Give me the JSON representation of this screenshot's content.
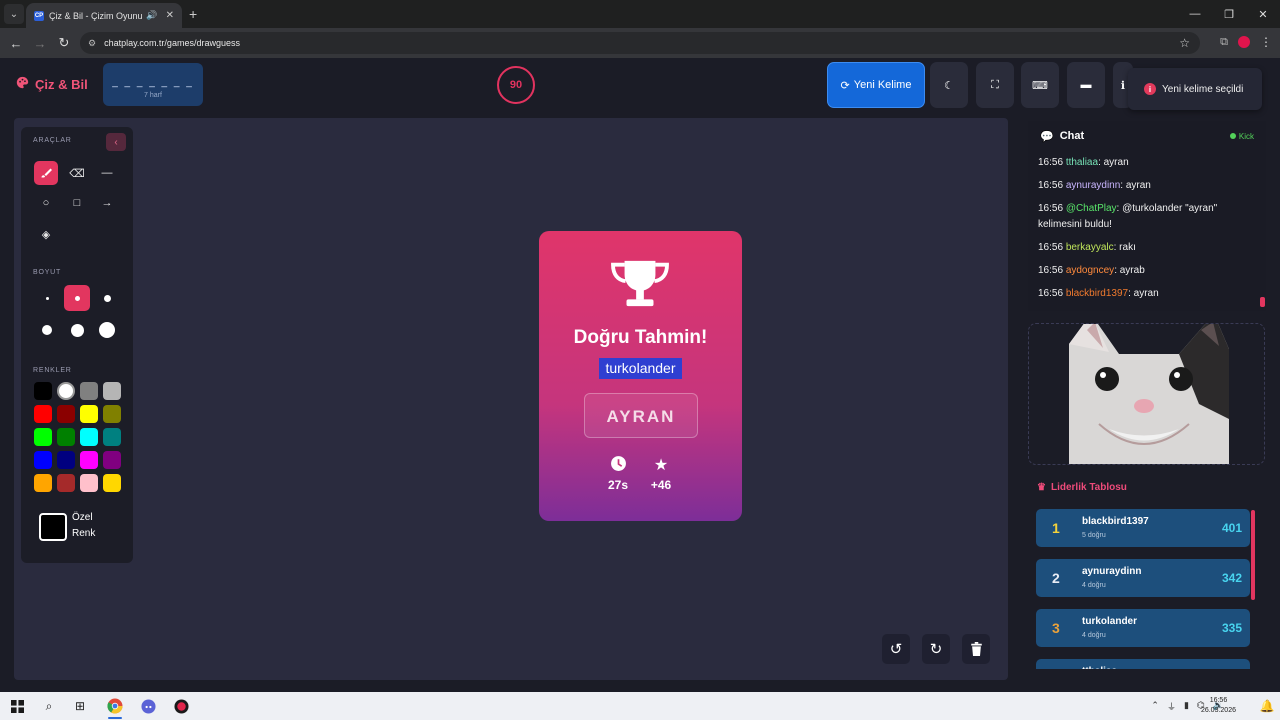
{
  "browser": {
    "tab_title": "Çiz & Bil - Çizim Oyunu",
    "favicon_text": "CP",
    "url": "chatplay.com.tr/games/drawguess"
  },
  "header": {
    "logo": "Çiz & Bil",
    "word_dashes": "_ _ _ _ _ _ _",
    "word_letters": "7 harf",
    "timer": "90",
    "new_word_label": "Yeni Kelime",
    "toast": "Yeni kelime seçildi"
  },
  "tools": {
    "tools_label": "ARAÇLAR",
    "size_label": "BOYUT",
    "colors_label": "RENKLER",
    "custom_label_1": "Özel",
    "custom_label_2": "Renk",
    "colors": [
      "#000000",
      "#ffffff",
      "#808080",
      "#b5b5b5",
      "#ff0000",
      "#8b0000",
      "#ffff00",
      "#808000",
      "#00ff00",
      "#008000",
      "#00ffff",
      "#008080",
      "#0000ff",
      "#000080",
      "#ff00ff",
      "#800080",
      "#ffa500",
      "#a52a2a",
      "#ffc0cb",
      "#ffd700"
    ]
  },
  "result": {
    "title": "Doğru Tahmin!",
    "winner": "turkolander",
    "answer": "AYRAN",
    "time": "27s",
    "points": "+46"
  },
  "chat": {
    "title": "Chat",
    "kick_label": "Kick",
    "messages": [
      {
        "time": "16:56",
        "user": "tthaliaa",
        "text": ": ayran"
      },
      {
        "time": "16:56",
        "user": "aynuraydinn",
        "text": ": ayran"
      },
      {
        "time": "16:56",
        "user": "@ChatPlay",
        "text": ": @turkolander \"ayran\" kelimesini buldu!"
      },
      {
        "time": "16:56",
        "user": "berkayyalc",
        "text": ": rakı"
      },
      {
        "time": "16:56",
        "user": "aydogncey",
        "text": ": ayrab"
      },
      {
        "time": "16:56",
        "user": "blackbird1397",
        "text": ": ayran"
      }
    ]
  },
  "leaderboard": {
    "title": "Liderlik Tablosu",
    "rows": [
      {
        "rank": "1",
        "name": "blackbird1397",
        "correct": "5 doğru",
        "score": "401"
      },
      {
        "rank": "2",
        "name": "aynuraydinn",
        "correct": "4 doğru",
        "score": "342"
      },
      {
        "rank": "3",
        "name": "turkolander",
        "correct": "4 doğru",
        "score": "335"
      },
      {
        "rank": "",
        "name": "tthaliaa",
        "correct": "",
        "score": ""
      }
    ]
  },
  "taskbar": {
    "time": "16:56",
    "date": "26.03.2026"
  }
}
